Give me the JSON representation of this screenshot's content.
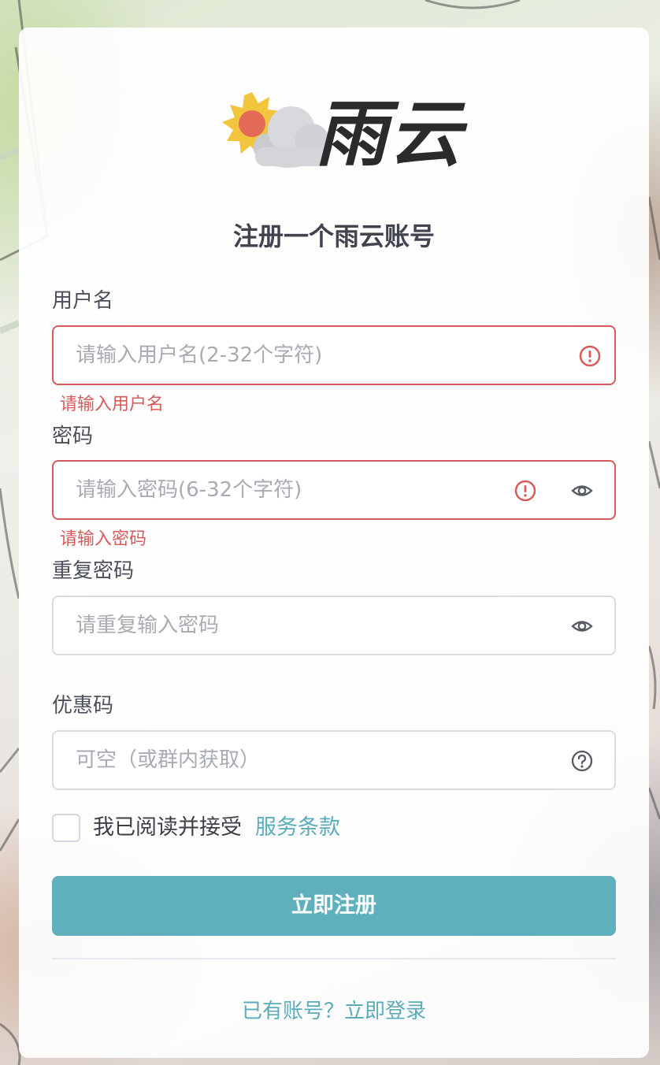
{
  "brand": {
    "name": "雨云",
    "logo_icon": "sun-cloud-rain-icon"
  },
  "page_title": "注册一个雨云账号",
  "form": {
    "username": {
      "label": "用户名",
      "value": "",
      "placeholder": "请输入用户名(2-32个字符)",
      "error": "请输入用户名",
      "status_icon": "error-circle-icon"
    },
    "password": {
      "label": "密码",
      "value": "",
      "placeholder": "请输入密码(6-32个字符)",
      "error": "请输入密码",
      "status_icon": "error-circle-icon",
      "toggle_icon": "eye-icon"
    },
    "confirm_password": {
      "label": "重复密码",
      "value": "",
      "placeholder": "请重复输入密码",
      "toggle_icon": "eye-icon"
    },
    "coupon": {
      "label": "优惠码",
      "value": "",
      "placeholder": "可空（或群内获取）",
      "help_icon": "question-circle-icon"
    },
    "agreement": {
      "checked": false,
      "text": "我已阅读并接受",
      "link": "服务条款"
    },
    "submit_label": "立即注册"
  },
  "footer": {
    "login_link": "已有账号？立即登录"
  },
  "colors": {
    "accent": "#5fb0bd",
    "link": "#5aacbb",
    "error": "#d95a5a",
    "title": "#41444f"
  }
}
